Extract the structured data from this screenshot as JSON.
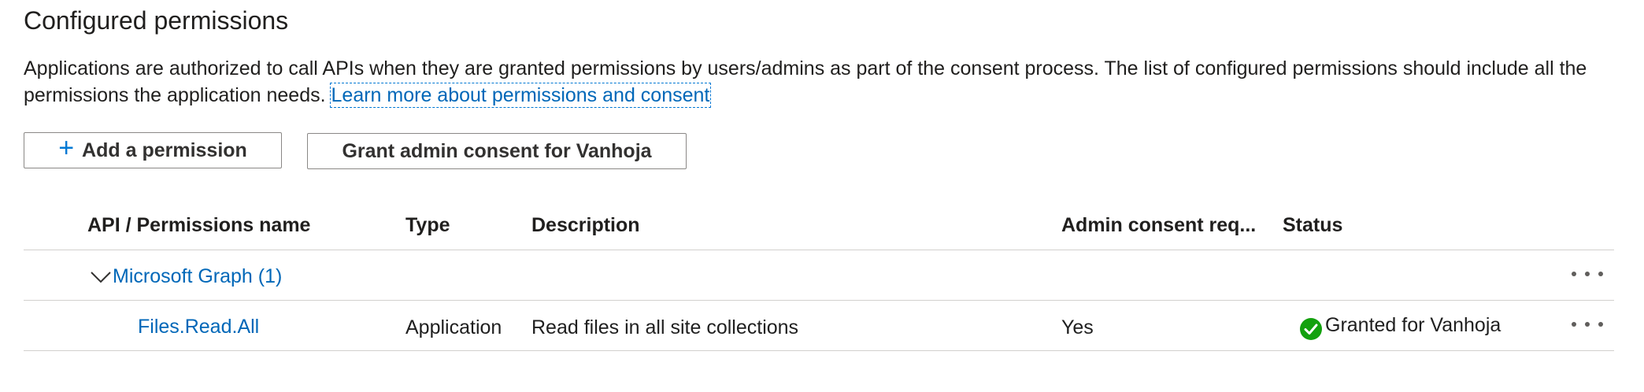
{
  "header": {
    "title": "Configured permissions",
    "description": "Applications are authorized to call APIs when they are granted permissions by users/admins as part of the consent process. The list of configured permissions should include all the permissions the application needs.",
    "learn_more_link": "Learn more about permissions and consent"
  },
  "toolbar": {
    "add_permission_label": "Add a permission",
    "grant_consent_label": "Grant admin consent for Vanhoja"
  },
  "table": {
    "columns": [
      "API / Permissions name",
      "Type",
      "Description",
      "Admin consent req...",
      "Status"
    ],
    "groups": [
      {
        "name": "Microsoft Graph (1)",
        "rows": [
          {
            "name": "Files.Read.All",
            "type": "Application",
            "description": "Read files in all site collections",
            "admin_consent": "Yes",
            "status": "Granted for Vanhoja"
          }
        ]
      }
    ]
  },
  "colors": {
    "link": "#0067b8",
    "accent": "#0078d4",
    "success": "#13a10e",
    "border": "#d2d0ce"
  },
  "icons": {
    "plus": "plus-icon",
    "expand": "chevron-down-icon",
    "more": "more-actions-icon",
    "status": "check-circle-icon"
  }
}
